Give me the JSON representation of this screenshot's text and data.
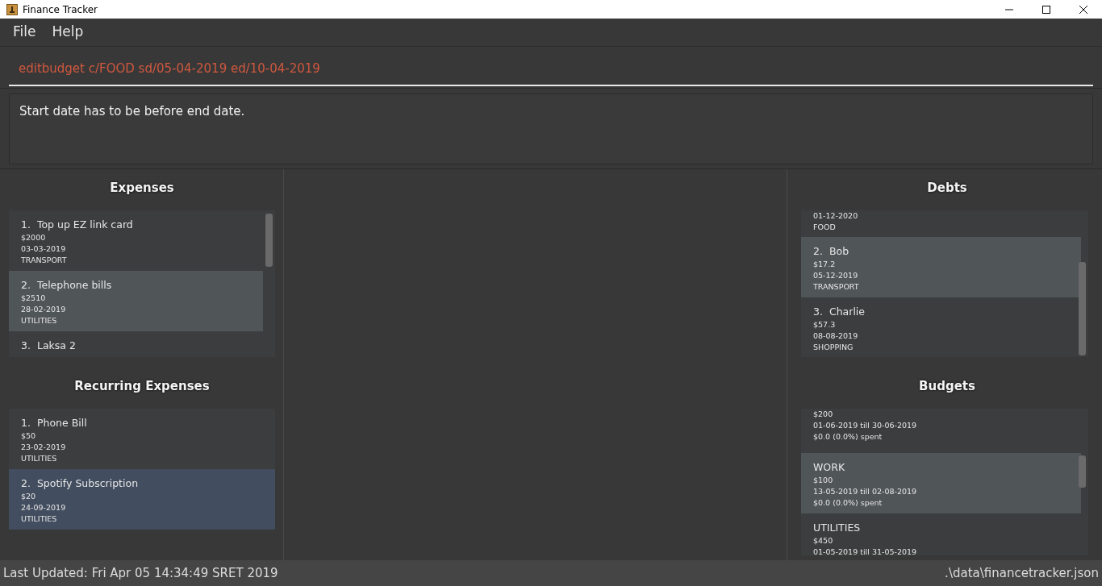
{
  "window": {
    "title": "Finance Tracker"
  },
  "menu": [
    "File",
    "Help"
  ],
  "command": {
    "value": "editbudget c/FOOD sd/05-04-2019 ed/10-04-2019"
  },
  "result": "Start date has to be before end date.",
  "expenses": {
    "title": "Expenses",
    "focused": false,
    "items": [
      {
        "index": "1.",
        "title": "Top up EZ link card",
        "lines": [
          "$2000",
          "03-03-2019",
          "TRANSPORT"
        ],
        "selected": false
      },
      {
        "index": "2.",
        "title": "Telephone bills",
        "lines": [
          "$2510",
          "28-02-2019",
          "UTILITIES"
        ],
        "selected": true
      },
      {
        "index": "3.",
        "title": "Laksa 2",
        "selected": false
      }
    ]
  },
  "recurring": {
    "title": "Recurring Expenses",
    "focused": true,
    "items": [
      {
        "index": "1.",
        "title": "Phone Bill",
        "lines": [
          "$50",
          "23-02-2019",
          "UTILITIES"
        ],
        "selected": false
      },
      {
        "index": "2.",
        "title": "Spotify Subscription",
        "lines": [
          "$20",
          "24-09-2019",
          "UTILITIES"
        ],
        "selected": true
      }
    ]
  },
  "debts": {
    "title": "Debts",
    "focused": false,
    "items": [
      {
        "lines": [
          "01-12-2020",
          "FOOD"
        ],
        "selected": false
      },
      {
        "index": "2.",
        "title": "Bob",
        "lines": [
          "$17.2",
          "05-12-2019",
          "TRANSPORT"
        ],
        "selected": true
      },
      {
        "index": "3.",
        "title": "Charlie",
        "lines": [
          "$57.3",
          "08-08-2019",
          "SHOPPING"
        ],
        "selected": false
      }
    ]
  },
  "budgets": {
    "title": "Budgets",
    "focused": false,
    "items": [
      {
        "lines": [
          "$200",
          "01-06-2019 till 30-06-2019",
          "$0.0 (0.0%) spent"
        ],
        "selected": false
      },
      {
        "title": "WORK",
        "lines": [
          "$100",
          "13-05-2019 till 02-08-2019",
          "$0.0 (0.0%) spent"
        ],
        "selected": true
      },
      {
        "title": "UTILITIES",
        "lines": [
          "$450",
          "01-05-2019 till 31-05-2019"
        ],
        "selected": false
      }
    ]
  },
  "status_bar": {
    "left": "Last Updated: Fri Apr 05 14:34:49 SRET 2019",
    "right": ".\\data\\financetracker.json"
  }
}
